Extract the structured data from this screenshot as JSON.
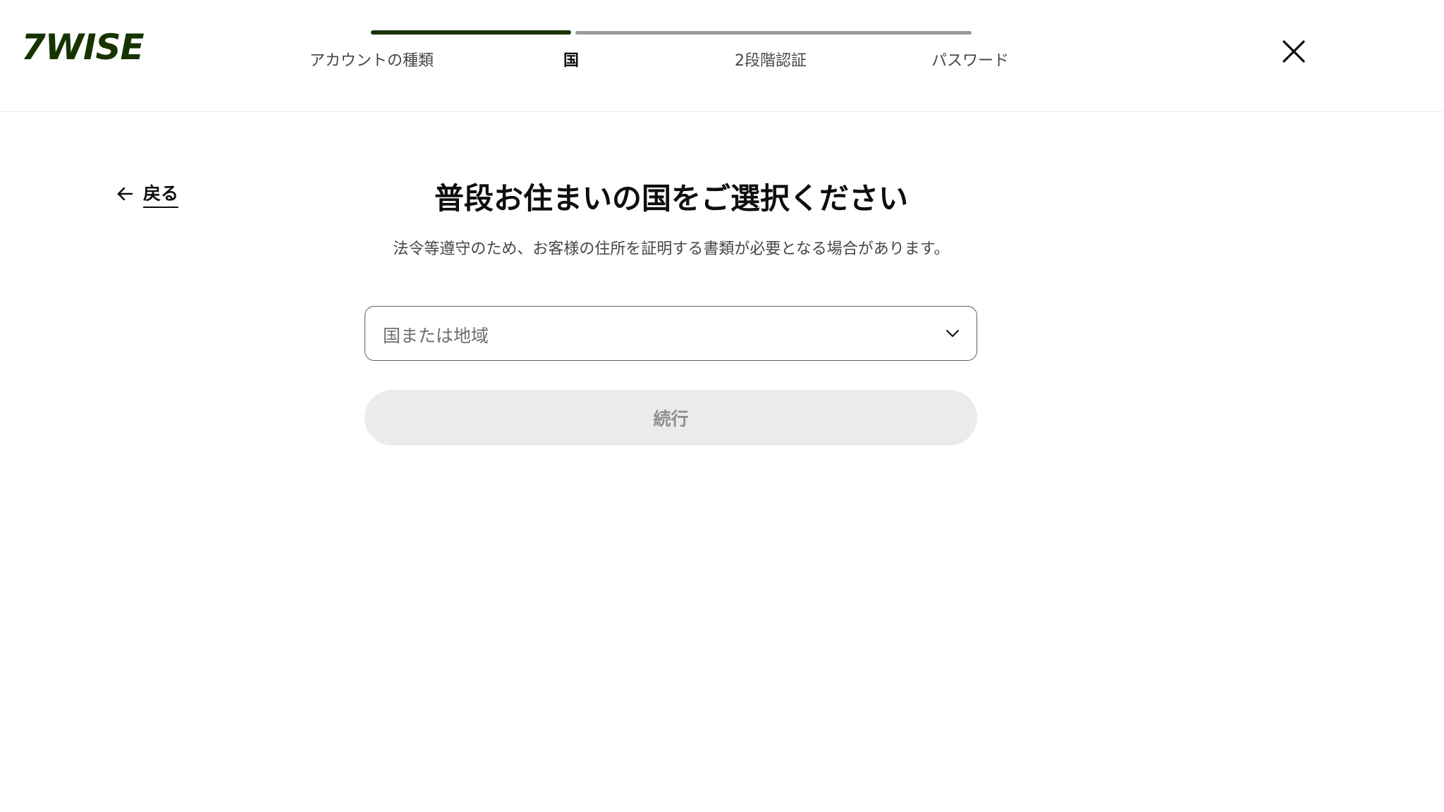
{
  "header": {
    "logo_text": "7WISE",
    "steps": [
      {
        "label": "アカウントの種類",
        "state": "done"
      },
      {
        "label": "国",
        "state": "active"
      },
      {
        "label": "2段階認証",
        "state": "upcoming"
      },
      {
        "label": "パスワード",
        "state": "upcoming"
      }
    ],
    "close_icon": "close-icon"
  },
  "main": {
    "back_label": "戻る",
    "title": "普段お住まいの国をご選択ください",
    "subtitle": "法令等遵守のため、お客様の住所を証明する書類が必要となる場合があります。",
    "country_select": {
      "placeholder": "国または地域",
      "icon": "chevron-down-icon"
    },
    "continue_label": "続行"
  },
  "colors": {
    "brand": "#163300",
    "text": "#0e0f0c",
    "muted": "#454745",
    "button_disabled_bg": "#ebebeb",
    "button_disabled_text": "#8f8f8f"
  }
}
